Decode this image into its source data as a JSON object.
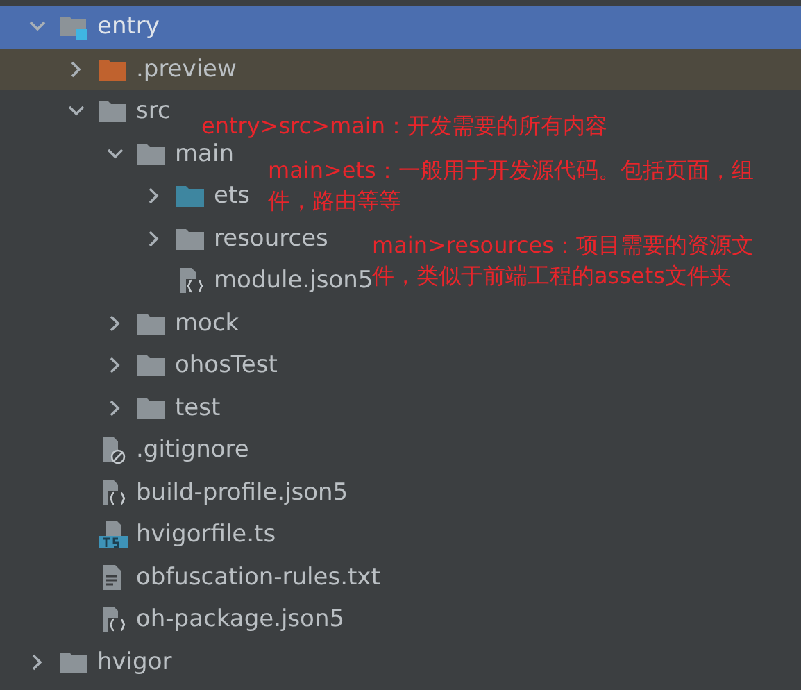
{
  "tree": [
    {
      "name": "entry",
      "kind": "module",
      "expanded": true,
      "selected": true,
      "excluded": false,
      "children": [
        {
          "name": ".preview",
          "kind": "folder",
          "color": "#c0622e",
          "expanded": false,
          "selected": false,
          "excluded": true
        },
        {
          "name": "src",
          "kind": "folder",
          "color": "#8c9398",
          "expanded": true,
          "selected": false,
          "excluded": false,
          "children": [
            {
              "name": "main",
              "kind": "folder",
              "color": "#8c9398",
              "expanded": true,
              "selected": false,
              "excluded": false,
              "children": [
                {
                  "name": "ets",
                  "kind": "folder",
                  "color": "#3e86a0",
                  "expanded": false,
                  "selected": false,
                  "excluded": false
                },
                {
                  "name": "resources",
                  "kind": "folder",
                  "color": "#8c9398",
                  "expanded": false,
                  "selected": false,
                  "excluded": false
                },
                {
                  "name": "module.json5",
                  "kind": "json",
                  "selected": false,
                  "excluded": false
                }
              ]
            },
            {
              "name": "mock",
              "kind": "folder",
              "color": "#8c9398",
              "expanded": false,
              "selected": false,
              "excluded": false
            },
            {
              "name": "ohosTest",
              "kind": "folder",
              "color": "#8c9398",
              "expanded": false,
              "selected": false,
              "excluded": false
            },
            {
              "name": "test",
              "kind": "folder",
              "color": "#8c9398",
              "expanded": false,
              "selected": false,
              "excluded": false
            }
          ]
        },
        {
          "name": ".gitignore",
          "kind": "ignore",
          "selected": false,
          "excluded": false
        },
        {
          "name": "build-profile.json5",
          "kind": "json",
          "selected": false,
          "excluded": false
        },
        {
          "name": "hvigorfile.ts",
          "kind": "ts",
          "selected": false,
          "excluded": false
        },
        {
          "name": "obfuscation-rules.txt",
          "kind": "text",
          "selected": false,
          "excluded": false
        },
        {
          "name": "oh-package.json5",
          "kind": "json",
          "selected": false,
          "excluded": false
        }
      ]
    },
    {
      "name": "hvigor",
      "kind": "folder",
      "color": "#8c9398",
      "expanded": false,
      "selected": false,
      "excluded": false
    }
  ],
  "annotations": [
    {
      "text": "entry>src>main：开发需要的所有内容"
    },
    {
      "text": "main>ets：一般用于开发源代码。包括页面，组件，路由等等"
    },
    {
      "text": "main>resources：项目需要的资源文件，类似于前端工程的assets文件夹"
    }
  ]
}
